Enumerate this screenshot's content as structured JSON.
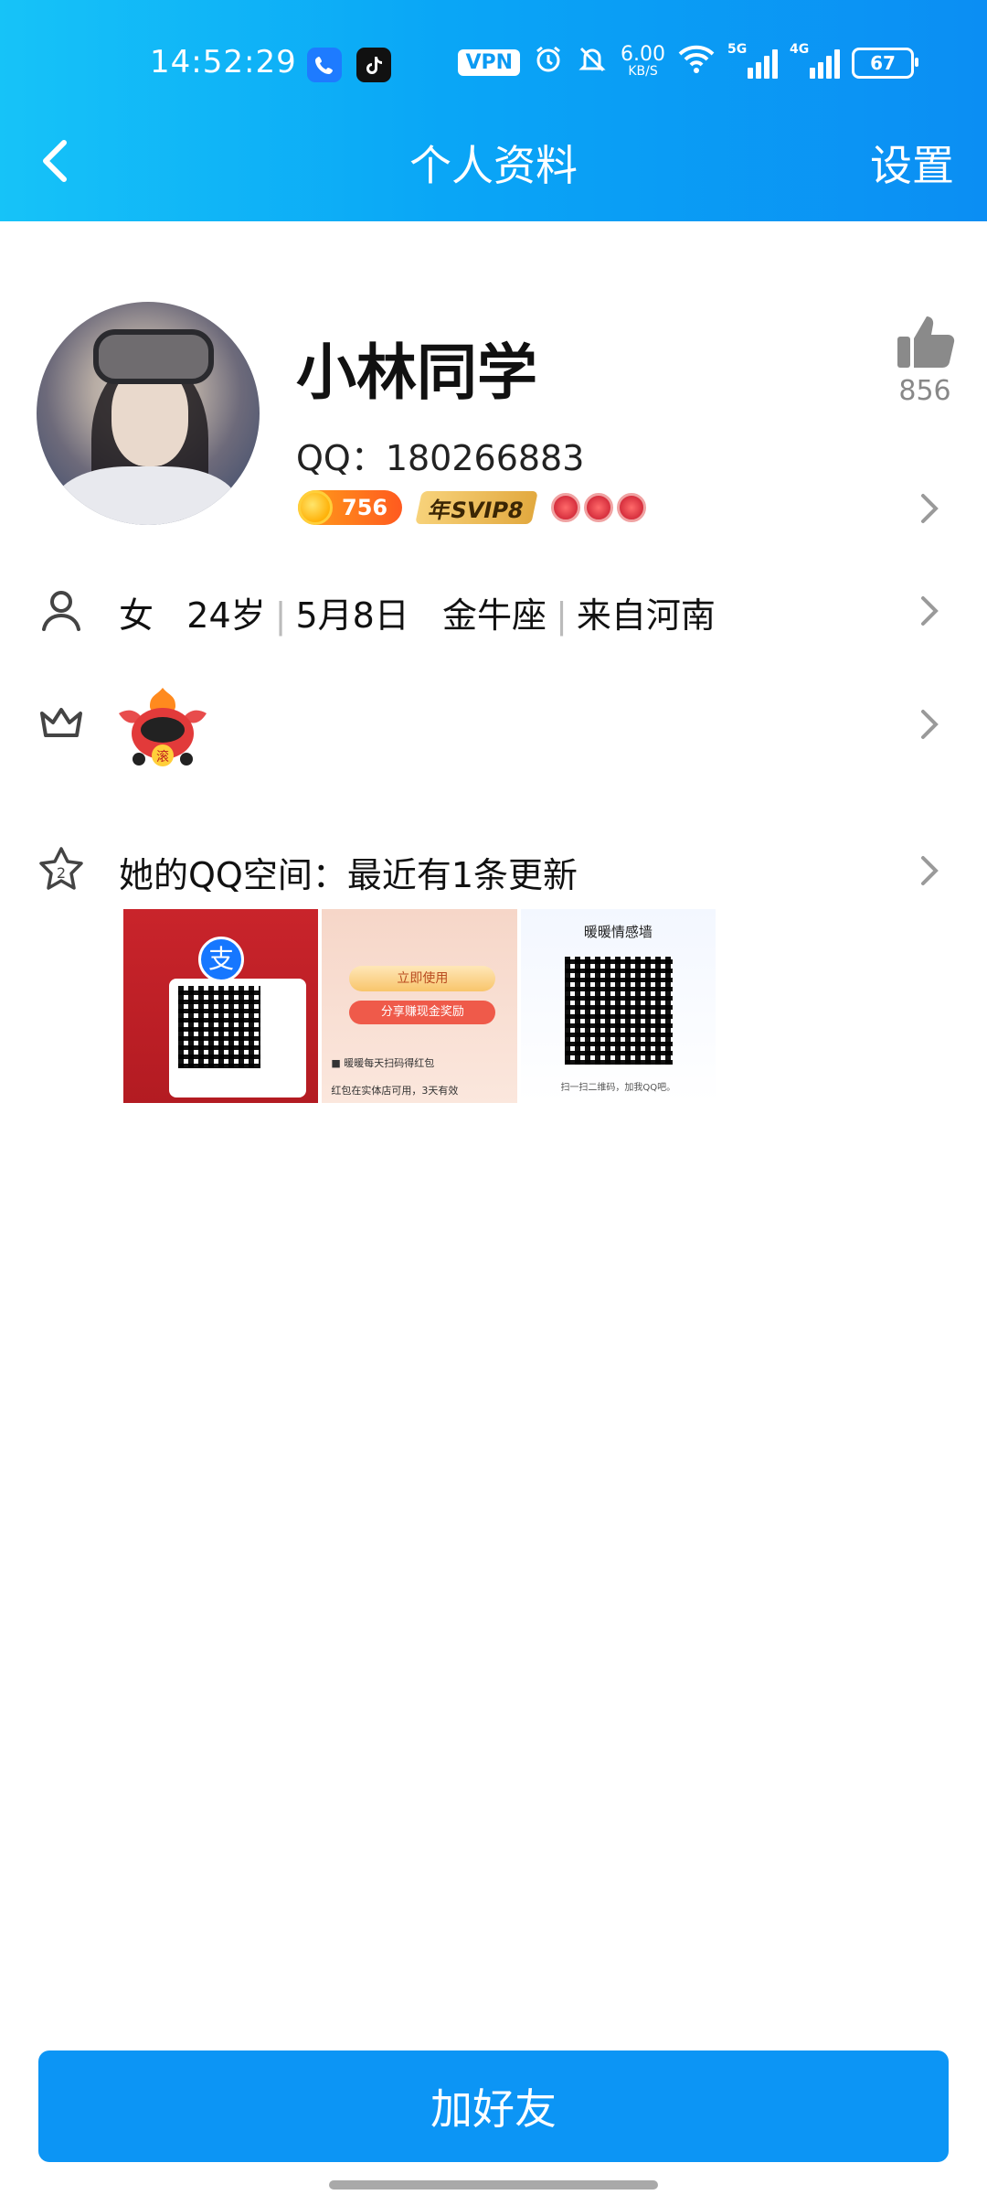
{
  "status_bar": {
    "time": "14:52:29",
    "vpn": "VPN",
    "speed_value": "6.00",
    "speed_unit": "KB/S",
    "sig1": "5G",
    "sig2": "4G",
    "battery": "67"
  },
  "header": {
    "title": "个人资料",
    "settings_label": "设置"
  },
  "profile": {
    "nickname": "小林同学",
    "qq_label": "QQ：180266883",
    "coin_level": "756",
    "svip_label": "年SVIP8",
    "likes": "856"
  },
  "rows": {
    "gender": "女",
    "age": "24岁",
    "birthday": "5月8日",
    "zodiac": "金牛座",
    "hometown": "来自河南",
    "sep": "|",
    "mascot_badge": "滚",
    "space_label": "她的QQ空间：最近有1条更新"
  },
  "photos": {
    "p2_btn1": "立即使用",
    "p2_btn2": "分享赚现金奖励",
    "p2_txt1": "■ 暖暖每天扫码得红包",
    "p2_txt2": "红包在实体店可用，3天有效",
    "p3_title": "暖暖情感墙",
    "p3_caption": "扫一扫二维码，加我QQ吧。"
  },
  "actions": {
    "add_friend": "加好友"
  },
  "colors": {
    "header_start": "#16c3f8",
    "header_end": "#0b8ef3",
    "primary_button": "#0c95f5"
  }
}
